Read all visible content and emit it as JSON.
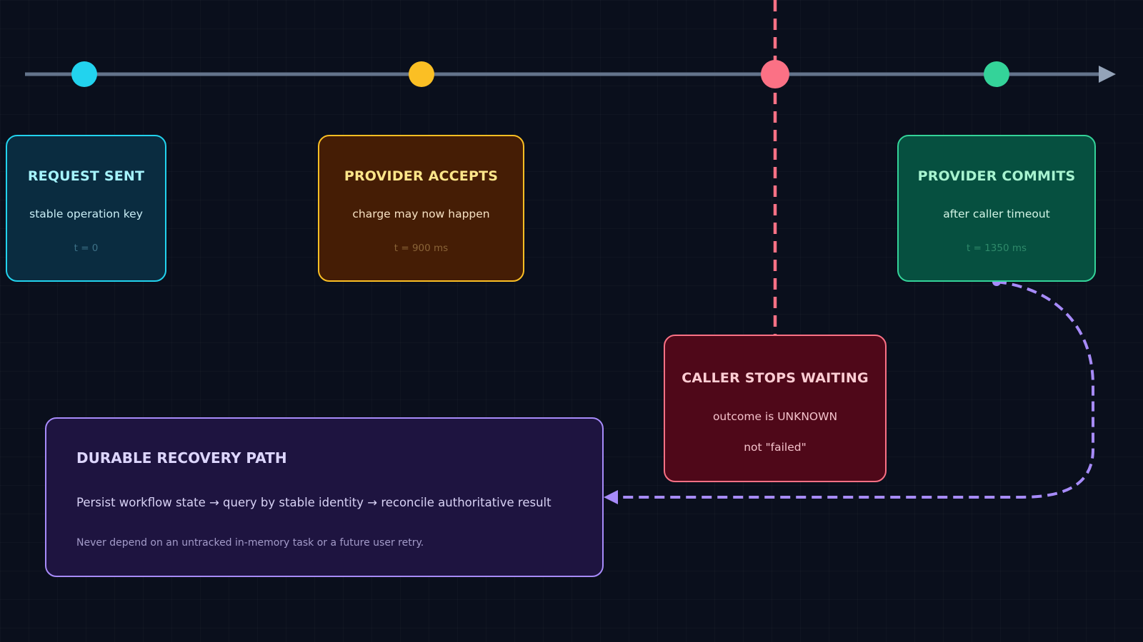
{
  "colors": {
    "background": "#0a0f1c",
    "timeline": "#64748b",
    "request": "#22d3ee",
    "accept": "#fbbf24",
    "caller": "#fb7185",
    "commit": "#34d399",
    "recovery": "#a78bfa"
  },
  "timeline": {
    "events": [
      "request",
      "accept",
      "caller_timeout",
      "commit"
    ]
  },
  "cards": {
    "request": {
      "title": "REQUEST SENT",
      "subtitle": "stable operation key",
      "time": "t = 0"
    },
    "accept": {
      "title": "PROVIDER ACCEPTS",
      "subtitle": "charge may now happen",
      "time": "t = 900 ms"
    },
    "commit": {
      "title": "PROVIDER COMMITS",
      "subtitle": "after caller timeout",
      "time": "t = 1350 ms"
    },
    "caller": {
      "title": "CALLER STOPS WAITING",
      "line1": "outcome is UNKNOWN",
      "line2": "not \"failed\""
    },
    "recovery": {
      "title": "DURABLE RECOVERY PATH",
      "body": "Persist workflow state → query by stable identity → reconcile authoritative result",
      "note": "Never depend on an untracked in-memory task or a future user retry."
    }
  }
}
